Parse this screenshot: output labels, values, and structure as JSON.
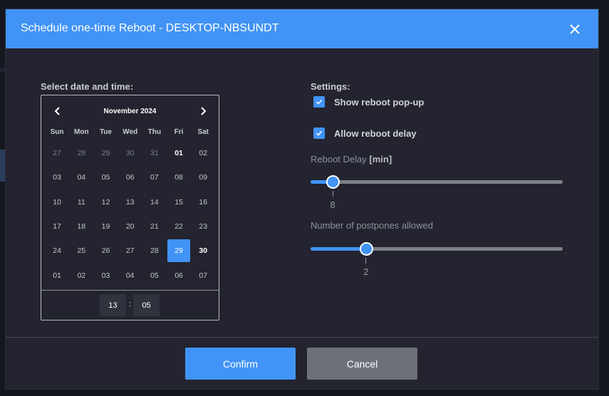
{
  "dialog": {
    "title": "Schedule one-time Reboot - DESKTOP-NBSUNDT"
  },
  "calendar": {
    "label": "Select date and time:",
    "month": "November 2024",
    "weekdays": [
      "Sun",
      "Mon",
      "Tue",
      "Wed",
      "Thu",
      "Fri",
      "Sat"
    ],
    "weeks": [
      [
        {
          "d": "27",
          "m": true
        },
        {
          "d": "28",
          "m": true
        },
        {
          "d": "29",
          "m": true
        },
        {
          "d": "30",
          "m": true
        },
        {
          "d": "31",
          "m": true
        },
        {
          "d": "01",
          "b": true
        },
        {
          "d": "02"
        }
      ],
      [
        {
          "d": "03"
        },
        {
          "d": "04"
        },
        {
          "d": "05"
        },
        {
          "d": "06"
        },
        {
          "d": "07"
        },
        {
          "d": "08"
        },
        {
          "d": "09"
        }
      ],
      [
        {
          "d": "10"
        },
        {
          "d": "11"
        },
        {
          "d": "12"
        },
        {
          "d": "13"
        },
        {
          "d": "14"
        },
        {
          "d": "15"
        },
        {
          "d": "16"
        }
      ],
      [
        {
          "d": "17"
        },
        {
          "d": "18"
        },
        {
          "d": "19"
        },
        {
          "d": "20"
        },
        {
          "d": "21"
        },
        {
          "d": "22"
        },
        {
          "d": "23"
        }
      ],
      [
        {
          "d": "24"
        },
        {
          "d": "25"
        },
        {
          "d": "26"
        },
        {
          "d": "27"
        },
        {
          "d": "28"
        },
        {
          "d": "29",
          "s": true
        },
        {
          "d": "30",
          "b": true
        }
      ],
      [
        {
          "d": "01"
        },
        {
          "d": "02"
        },
        {
          "d": "03"
        },
        {
          "d": "04"
        },
        {
          "d": "05"
        },
        {
          "d": "06"
        },
        {
          "d": "07"
        }
      ]
    ],
    "hour": "13",
    "minute": "05",
    "separator": ":"
  },
  "settings": {
    "label": "Settings:",
    "show_popup": {
      "label": "Show reboot pop-up",
      "checked": true
    },
    "allow_delay": {
      "label": "Allow reboot delay",
      "checked": true
    },
    "delay": {
      "label": "Reboot Delay",
      "unit": "[min]",
      "value": "8",
      "fraction": 0.088
    },
    "postpones": {
      "label": "Number of postpones allowed",
      "value": "2",
      "fraction": 0.22
    }
  },
  "footer": {
    "confirm": "Confirm",
    "cancel": "Cancel"
  },
  "colors": {
    "accent": "#4193f5",
    "dialog_bg": "#23242f",
    "cancel_bg": "#6d7079"
  }
}
